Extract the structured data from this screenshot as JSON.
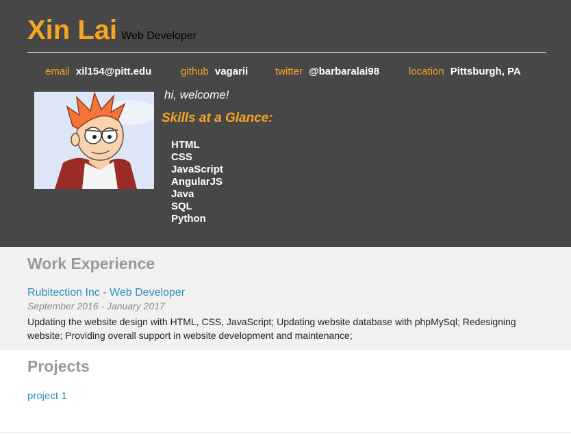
{
  "profile": {
    "name": "Xin Lai",
    "role": "Web Developer"
  },
  "contact": [
    {
      "label": "email",
      "value": "xil154@pitt.edu"
    },
    {
      "label": "github",
      "value": "vagarii"
    },
    {
      "label": "twitter",
      "value": "@barbaralai98"
    },
    {
      "label": "location",
      "value": "Pittsburgh, PA"
    }
  ],
  "intro": {
    "welcome": "hi, welcome!",
    "skills_title": "Skills at a Glance:",
    "skills": [
      "HTML",
      "CSS",
      "JavaScript",
      "AngularJS",
      "Java",
      "SQL",
      "Python"
    ]
  },
  "work": {
    "title": "Work Experience",
    "jobs": [
      {
        "title": "Rubitection Inc - Web Developer",
        "dates": "September 2016 - January 2017",
        "description": "Updating the website design with HTML, CSS, JavaScript; Updating website database with phpMySql; Redesigning website; Providing overall support in website development and maintenance;"
      }
    ]
  },
  "projects": {
    "title": "Projects",
    "items": [
      {
        "label": "project 1"
      }
    ]
  },
  "colors": {
    "header_bg": "#474747",
    "accent": "#f5a623",
    "link": "#2a8fbd",
    "section_title": "#999999"
  }
}
